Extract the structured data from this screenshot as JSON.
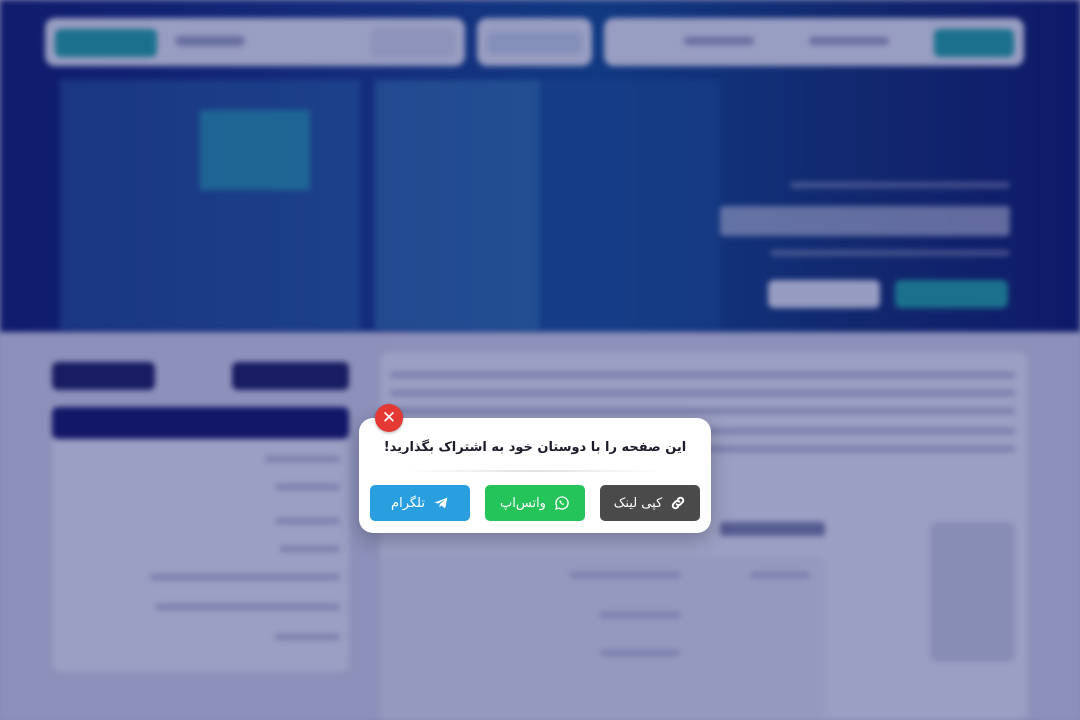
{
  "share_modal": {
    "title": "این صفحه را با دوستان خود به اشتراک بگذارید!",
    "close_icon": "close-icon",
    "buttons": [
      {
        "label": "کپی لینک",
        "icon": "link-icon",
        "color": "#4a4a4a"
      },
      {
        "label": "واتس‌اپ",
        "icon": "whatsapp-icon",
        "color": "#25c45a"
      },
      {
        "label": "تلگرام",
        "icon": "telegram-icon",
        "color": "#2a9fe0"
      }
    ]
  },
  "colors": {
    "close": "#e53935",
    "overlay": "rgba(20,25,110,0.38)"
  }
}
